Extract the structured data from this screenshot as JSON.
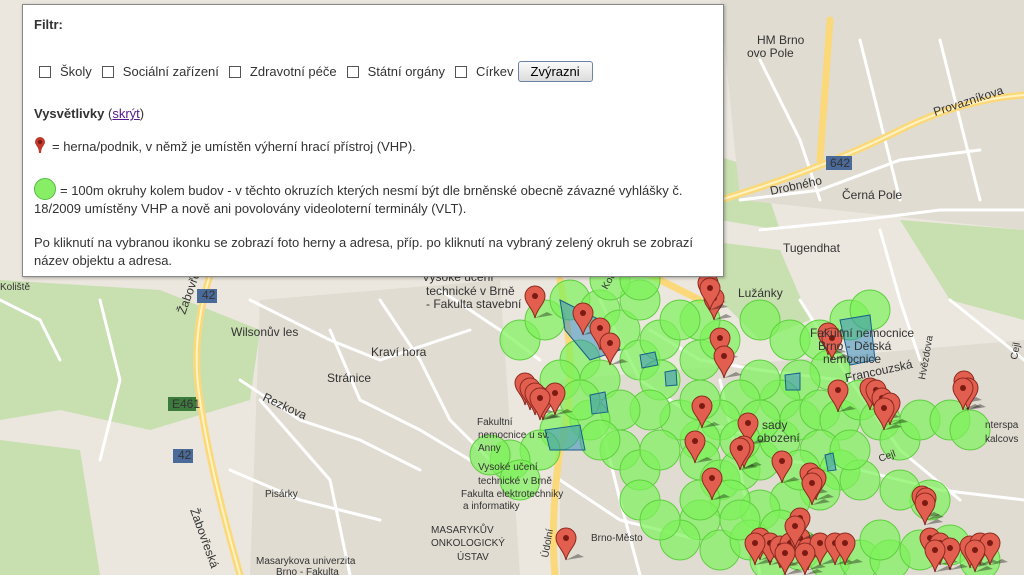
{
  "filter_panel": {
    "title": "Filtr:",
    "checkboxes": [
      {
        "label": "Školy",
        "checked": false
      },
      {
        "label": "Sociální zařízení",
        "checked": false
      },
      {
        "label": "Zdravotní péče",
        "checked": false
      },
      {
        "label": "Státní orgány",
        "checked": false
      },
      {
        "label": "Církev",
        "checked": false
      }
    ],
    "highlight_button": "Zvýrazni",
    "legend_title": "Vysvětlivky",
    "legend_toggle_prefix": "(",
    "legend_toggle": "skrýt",
    "legend_toggle_suffix": ")",
    "legend_marker_text": "= herna/podnik, v němž je umístěn výherní hrací přístroj (VHP).",
    "legend_circle_text": "= 100m okruhy kolem budov - v těchto okruzích kterých nesmí být dle brněnské obecně závazné vyhlášky č. 18/2009 umístěny VHP a nově ani povolovány videoloterní terminály (VLT).",
    "legend_note": "Po kliknutí na vybranou ikonku se zobrazí foto herny a adresa, příp. po kliknutí na vybraný zelený okruh se zobrazí název objektu a adresa."
  },
  "map": {
    "colors": {
      "background": "#ebe7de",
      "park": "#c8dfb0",
      "road_major": "#fde293",
      "road": "#ffffff",
      "circle": "#7ef25a",
      "marker": "#e25e4f"
    },
    "labels": [
      "HM Brno",
      "ovo Pole",
      "Provazníkova",
      "642",
      "Drobného",
      "Černá Pole",
      "Tugendhat",
      "Lužánky",
      "Fakultní nemocnice",
      "Brno - Dětská",
      "nemocnice",
      "Vysoké učení",
      "technické v Brně",
      "- Fakulta stavební",
      "Wilsonův les",
      "Kraví hora",
      "Stránice",
      "Rezkova",
      "E461",
      "42",
      "42",
      "Žabovřeská",
      "Žabovřeská",
      "Francouzská",
      "sady",
      "obození",
      "Hvězdova",
      "Cejl",
      "nterspa",
      "kalcovs",
      "Fakultní",
      "nemocnice u sv.",
      "Anny",
      "Vysoké učení",
      "technické v Brně",
      "Fakulta elektrotechniky",
      "a informatiky",
      "Pisárky",
      "MASARYKŮV",
      "ONKOLOGICKÝ",
      "ÚSTAV",
      "Masarykova univerzita",
      "Brno - Fakulta",
      "Brno-Město",
      "Údolní",
      "Kounicova",
      "Cejl",
      "Koliště"
    ],
    "marker_count": 62,
    "circle_count": 90
  }
}
